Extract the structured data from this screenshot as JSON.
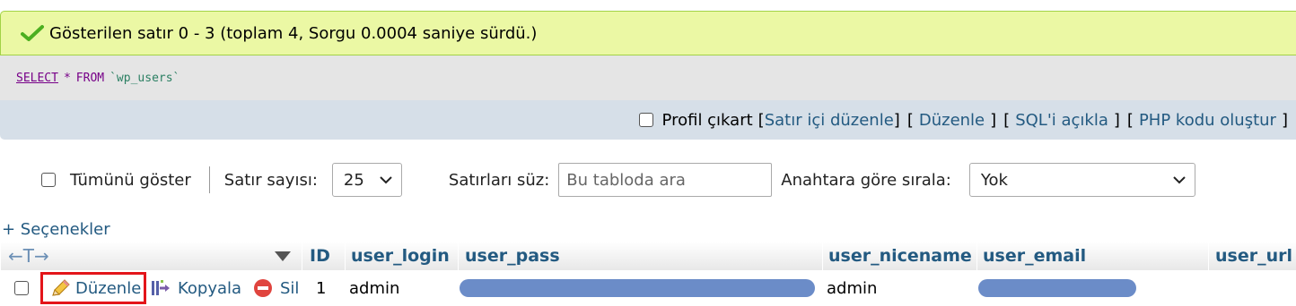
{
  "success": {
    "icon": "check-icon",
    "message": "Gösterilen satır 0 - 3 (toplam 4, Sorgu 0.0004 saniye sürdü.)"
  },
  "sql": {
    "select": "SELECT",
    "star": "*",
    "from": "FROM",
    "table": "`wp_users`"
  },
  "tools": {
    "profile_label": "Profil çıkart",
    "inline_edit": "Satır içi düzenle",
    "edit": "Düzenle",
    "explain_sql": "SQL'i açıkla",
    "php_code": "PHP kodu oluştur"
  },
  "nav": {
    "show_all_label": "Tümünü göster",
    "row_count_label": "Satır sayısı:",
    "row_count_value": "25",
    "filter_label": "Satırları süz:",
    "filter_placeholder": "Bu tabloda ara",
    "sort_label": "Anahtara göre sırala:",
    "sort_value": "Yok"
  },
  "options_link": "+ Seçenekler",
  "table": {
    "arrows": "←T→",
    "columns": [
      "ID",
      "user_login",
      "user_pass",
      "user_nicename",
      "user_email",
      "user_url"
    ],
    "row": {
      "edit": "Düzenle",
      "copy": "Kopyala",
      "delete": "Sil",
      "id": "1",
      "user_login": "admin",
      "user_nicename": "admin"
    }
  },
  "colors": {
    "link": "#235a81",
    "success_bg": "#ebf8a4",
    "highlight_border": "#e3151a"
  }
}
